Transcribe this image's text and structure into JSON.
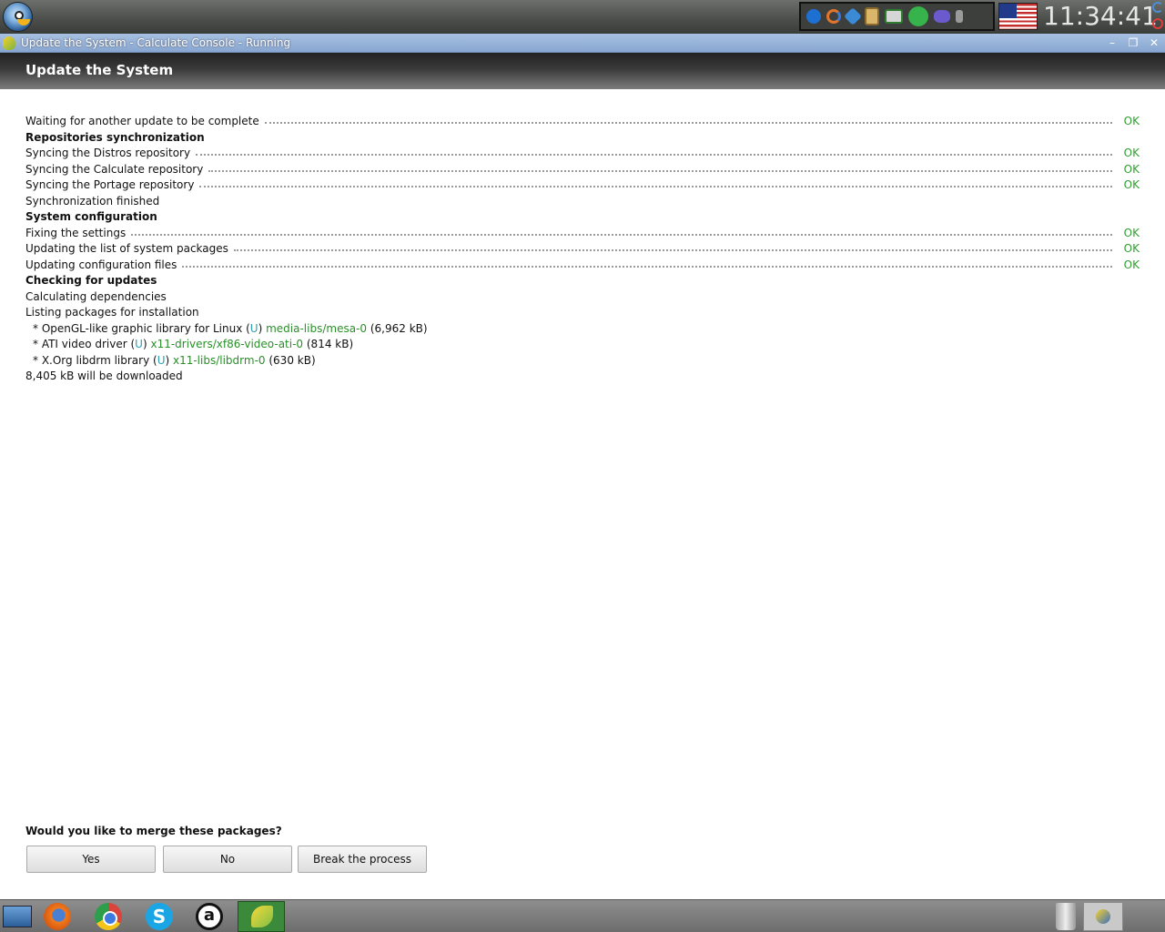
{
  "panel": {
    "clock": "11:34:41"
  },
  "window": {
    "title": "Update the System - Calculate Console - Running",
    "minimize_glyph": "–",
    "restore_glyph": "❐",
    "close_glyph": "✕"
  },
  "header": {
    "title": "Update the System"
  },
  "log": {
    "waiting": "Waiting for another update to be complete",
    "ok": "OK",
    "repos_heading": "Repositories synchronization",
    "sync_distros": "Syncing the Distros repository",
    "sync_calculate": "Syncing the Calculate repository",
    "sync_portage": "Syncing the Portage repository",
    "sync_finished": "Synchronization finished",
    "config_heading": "System configuration",
    "fixing": "Fixing the settings",
    "updating_list": "Updating the list of system packages",
    "updating_config": "Updating configuration files",
    "checking_heading": "Checking for updates",
    "calculating": "Calculating dependencies",
    "listing": "Listing packages for installation",
    "packages": [
      {
        "prefix": "* OpenGL-like graphic library for Linux (",
        "flag": "U",
        "close": ") ",
        "atom": "media-libs/mesa-0",
        "size": " (6,962 kB)"
      },
      {
        "prefix": "* ATI video driver (",
        "flag": "U",
        "close": ") ",
        "atom": "x11-drivers/xf86-video-ati-0",
        "size": " (814 kB)"
      },
      {
        "prefix": "* X.Org libdrm library (",
        "flag": "U",
        "close": ") ",
        "atom": "x11-libs/libdrm-0",
        "size": " (630 kB)"
      }
    ],
    "download_total": "8,405 kB will be downloaded"
  },
  "prompt": {
    "question": "Would you like to merge these packages?",
    "yes_label": "Yes",
    "no_label": "No",
    "break_label": "Break the process"
  },
  "taskbar": {
    "skype_glyph": "S",
    "amazon_glyph": "a"
  },
  "colors": {
    "ok_green": "#2e9f2e",
    "atom_green": "#2a8f2a",
    "flag_cyan": "#2aa0b0",
    "title_bar_blue": "#9ab5dc"
  }
}
